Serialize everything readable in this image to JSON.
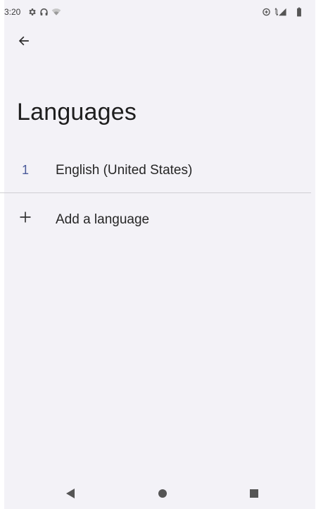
{
  "status_bar": {
    "time": "3:20",
    "icons": [
      "settings-icon",
      "headphones-icon",
      "wifi-icon",
      "data-saver-icon",
      "signal-icon",
      "battery-icon"
    ]
  },
  "header": {
    "back_icon": "arrow-back-icon",
    "title": "Languages"
  },
  "languages": [
    {
      "index": "1",
      "label": "English (United States)"
    }
  ],
  "add_language": {
    "icon": "plus-icon",
    "label": "Add a language"
  },
  "nav_bar": {
    "buttons": [
      "back-triangle-icon",
      "home-circle-icon",
      "recents-square-icon"
    ]
  },
  "colors": {
    "background": "#f3f2f7",
    "index_accent": "#4a5a9a",
    "text": "#262626"
  }
}
